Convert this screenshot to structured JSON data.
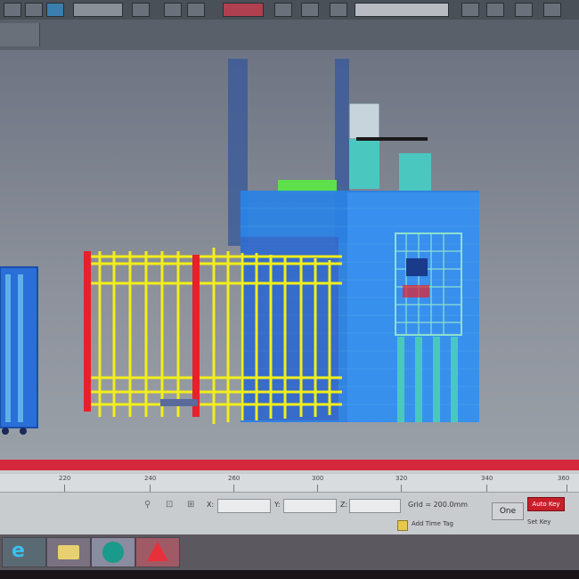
{
  "ruler": {
    "ticks": [
      "220",
      "240",
      "260",
      "300",
      "320",
      "340",
      "360"
    ]
  },
  "coords": {
    "x_label": "X:",
    "y_label": "Y:",
    "z_label": "Z:",
    "grid": "Grid = 200.0mm"
  },
  "controls": {
    "one": "One",
    "auto_key": "Auto Key",
    "set_key": "Set Key",
    "add_time_tag": "Add Time Tag"
  },
  "colors": {
    "fence_yellow": "#f2ee1a",
    "fence_red": "#e8202a",
    "structure_blue": "#2a82e6",
    "accent_red": "#d6283b"
  },
  "taskbar": {
    "apps": [
      "internet-explorer-icon",
      "file-explorer-icon",
      "publisher-icon",
      "autodesk-icon"
    ]
  }
}
